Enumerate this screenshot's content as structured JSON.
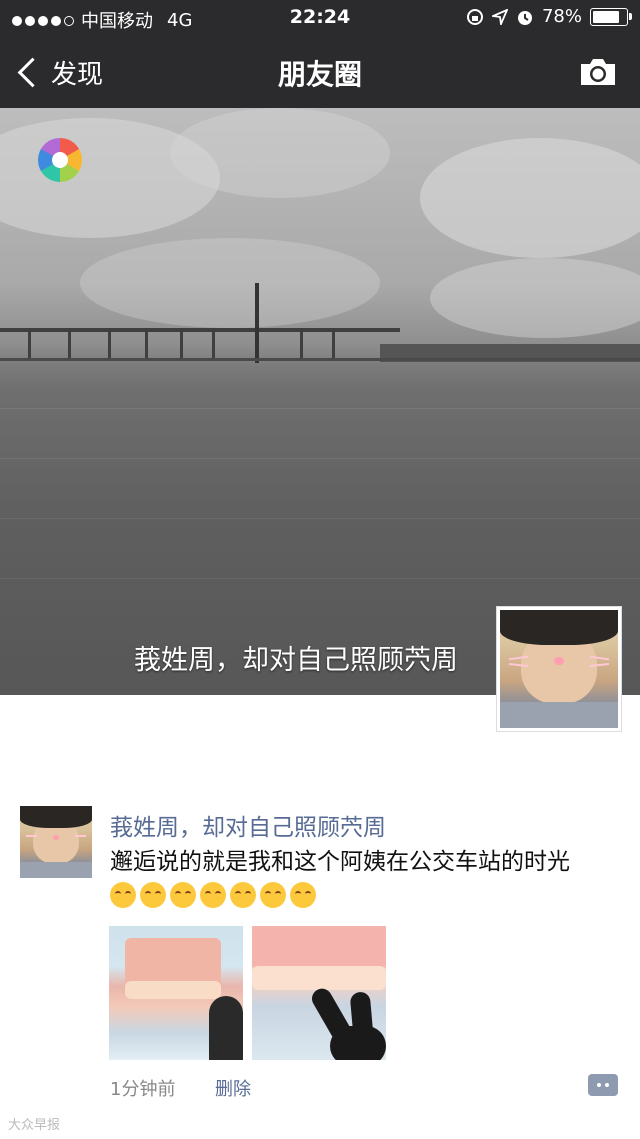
{
  "status_bar": {
    "carrier": "中国移动",
    "network": "4G",
    "time": "22:24",
    "battery": "78%",
    "battery_level": 0.78
  },
  "nav": {
    "back_label": "发现",
    "title": "朋友圈"
  },
  "cover": {
    "user_name": "莪姓周，却对自己照顾茓周"
  },
  "post": {
    "author": "莪姓周，却对自己照顾茓周",
    "text": "邂逅说的就是我和这个阿姨在公交车站的时光",
    "emoji_count": 7,
    "time_ago": "1分钟前",
    "delete_label": "删除"
  },
  "watermark": "大众早报",
  "colors": {
    "nav_bg": "#2b2b2d",
    "link_blue": "#576b95",
    "emoji_yellow": "#fcc93d"
  }
}
